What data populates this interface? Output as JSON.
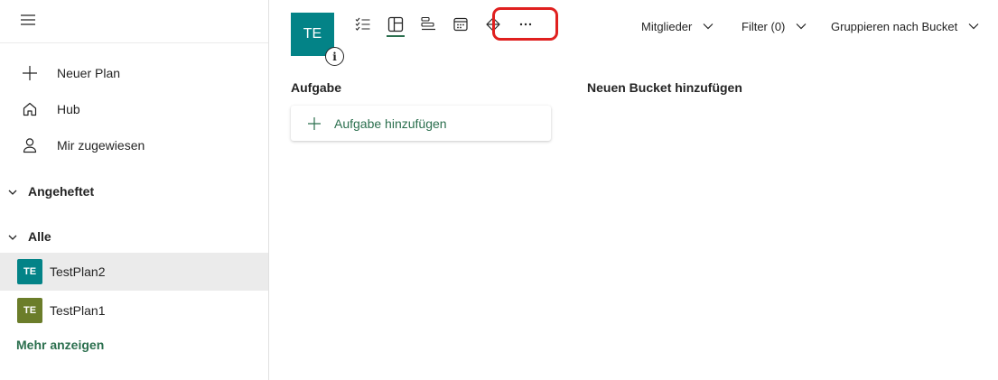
{
  "sidebar": {
    "nav": [
      {
        "label": "Neuer Plan",
        "icon": "plus-icon"
      },
      {
        "label": "Hub",
        "icon": "home-icon"
      },
      {
        "label": "Mir zugewiesen",
        "icon": "person-icon"
      }
    ],
    "sections": {
      "pinned": "Angeheftet",
      "all": "Alle"
    },
    "plans": [
      {
        "initials": "TE",
        "name": "TestPlan2",
        "color": "#038387",
        "selected": true
      },
      {
        "initials": "TE",
        "name": "TestPlan1",
        "color": "#6b7d2a",
        "selected": false
      }
    ],
    "more_label": "Mehr anzeigen"
  },
  "header": {
    "plan_initials": "TE",
    "plan_color": "#038387",
    "info_glyph": "i",
    "views": [
      "list-view-icon",
      "board-view-icon",
      "schedule-view-icon",
      "calendar-view-icon",
      "people-view-icon",
      "more-options-icon"
    ],
    "active_view": "board-view-icon",
    "highlight_color": "#e0201f",
    "members_label": "Mitglieder",
    "filter_label": "Filter (0)",
    "group_label": "Gruppieren nach Bucket"
  },
  "board": {
    "bucket_name": "Aufgabe",
    "add_task_label": "Aufgabe hinzufügen",
    "new_bucket_label": "Neuen Bucket hinzufügen"
  },
  "colors": {
    "accent_green": "#2b6f4e",
    "selected_bg": "#ebebeb"
  }
}
